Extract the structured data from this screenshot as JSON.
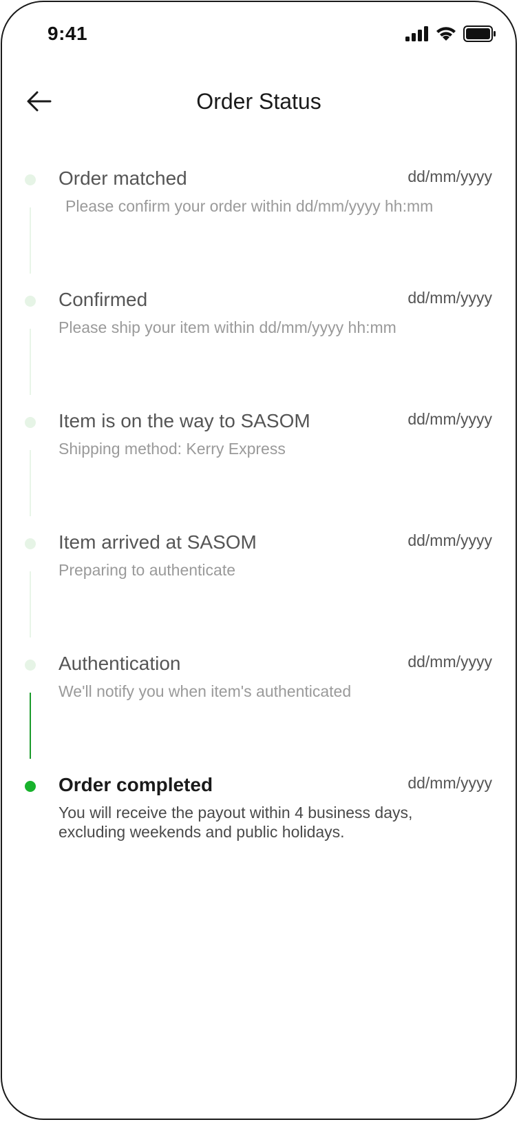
{
  "status_bar": {
    "time": "9:41",
    "icons": [
      "signal-icon",
      "wifi-icon",
      "battery-icon"
    ]
  },
  "header": {
    "title": "Order Status",
    "back_icon": "arrow-left-icon"
  },
  "colors": {
    "accent_green": "#18b22c",
    "inactive_dot": "#e6f4e6",
    "text_primary": "#1a1a1a",
    "text_secondary": "#9a9a9a"
  },
  "steps": [
    {
      "title": "Order matched",
      "date": "dd/mm/yyyy",
      "description": "Please confirm your order within dd/mm/yyyy hh:mm",
      "active": false
    },
    {
      "title": "Confirmed",
      "date": "dd/mm/yyyy",
      "description": "Please ship your item within dd/mm/yyyy hh:mm",
      "active": false
    },
    {
      "title": "Item is on the way to SASOM",
      "date": "dd/mm/yyyy",
      "description": "Shipping method: Kerry Express",
      "active": false
    },
    {
      "title": "Item arrived at SASOM",
      "date": "dd/mm/yyyy",
      "description": "Preparing to authenticate",
      "active": false
    },
    {
      "title": "Authentication",
      "date": "dd/mm/yyyy",
      "description": "We'll notify you when item's authenticated",
      "active": false
    },
    {
      "title": "Order completed",
      "date": "dd/mm/yyyy",
      "description": "You will receive the payout within 4 business days, excluding weekends and public holidays.",
      "active": true
    }
  ]
}
